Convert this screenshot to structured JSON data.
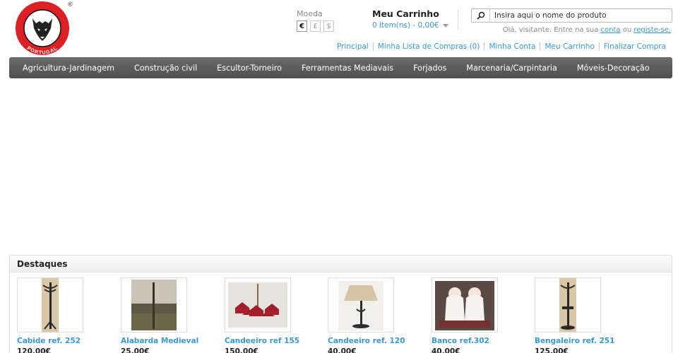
{
  "brand": {
    "logo_text": "LOBO",
    "logo_sub": "PORTUGAL",
    "registered": "®",
    "colors": {
      "red": "#dd1f26",
      "nav": "#5a5a5a",
      "link": "#3a9ad0"
    }
  },
  "currency": {
    "label": "Moeda",
    "options": [
      {
        "symbol": "€",
        "active": true
      },
      {
        "symbol": "£",
        "active": false
      },
      {
        "symbol": "$",
        "active": false
      }
    ]
  },
  "cart": {
    "title": "Meu Carrinho",
    "summary": "0 item(ns) - 0,00€"
  },
  "search": {
    "placeholder": "Insira aqui o nome do produto",
    "icon": "search-icon"
  },
  "welcome": {
    "prefix": "Olá, visitante. Entre na sua",
    "login_link": "conta",
    "middle": "ou",
    "register_link": "registe-se."
  },
  "toplinks": [
    "Principal",
    "Minha Lista de Compras (0)",
    "Minha Conta",
    "Meu Carrinho",
    "Finalizar Compra"
  ],
  "nav": [
    "Agricultura-Jardinagem",
    "Construção civil",
    "Escultor-Torneiro",
    "Ferramentas Mediavais",
    "Forjados",
    "Marcenaria/Carpintaria",
    "Móveis-Decoração"
  ],
  "featured": {
    "title": "Destaques",
    "products": [
      {
        "name": "Cabide ref. 252",
        "price": "120,00€"
      },
      {
        "name": "Alabarda Medieval",
        "price": "25,00€"
      },
      {
        "name": "Candeeiro ref 155",
        "price": "150,00€"
      },
      {
        "name": "Candeeiro ref. 120",
        "price": "40,00€"
      },
      {
        "name": "Banco ref.302",
        "price": "40,00€"
      },
      {
        "name": "Bengaleiro ref. 251",
        "price": "125,00€"
      }
    ]
  }
}
